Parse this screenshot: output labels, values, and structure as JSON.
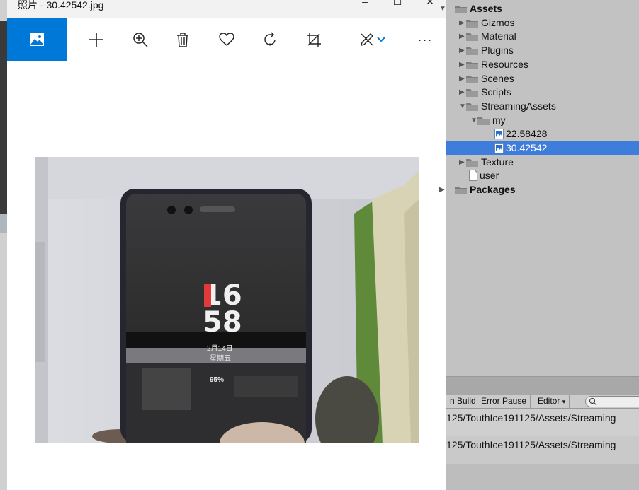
{
  "photos": {
    "title": "照片 - 30.42542.jpg",
    "window_buttons": {
      "minimize": "–",
      "maximize": "☐",
      "close": "✕"
    },
    "accent": "#0078d7",
    "toolbar": [
      "view-image",
      "add",
      "zoom-in",
      "delete",
      "favorite",
      "rotate",
      "crop",
      "edit",
      "more"
    ],
    "more_label": "···",
    "photo": {
      "clock_hour": "16",
      "clock_minute": "58",
      "date_line": "2月14日",
      "weekday_line": "星期五",
      "battery": "95%"
    }
  },
  "unity": {
    "tree": [
      {
        "label": "Assets",
        "type": "folder",
        "expanded": true,
        "bold": true
      },
      {
        "label": "Gizmos",
        "type": "folder"
      },
      {
        "label": "Material",
        "type": "folder"
      },
      {
        "label": "Plugins",
        "type": "folder"
      },
      {
        "label": "Resources",
        "type": "folder"
      },
      {
        "label": "Scenes",
        "type": "folder"
      },
      {
        "label": "Scripts",
        "type": "folder"
      },
      {
        "label": "StreamingAssets",
        "type": "folder",
        "expanded": true
      },
      {
        "label": "my",
        "type": "folder",
        "expanded": true
      },
      {
        "label": "22.58428",
        "type": "image"
      },
      {
        "label": "30.42542",
        "type": "image",
        "selected": true
      },
      {
        "label": "Texture",
        "type": "folder"
      },
      {
        "label": "user",
        "type": "file"
      },
      {
        "label": "Packages",
        "type": "folder",
        "bold": true
      }
    ],
    "console_bar": {
      "build": "n Build",
      "error_pause": "Error Pause",
      "editor": "Editor",
      "editor_arrow": "▾"
    },
    "logs": [
      "125/TouthIce191125/Assets/Streaming",
      "125/TouthIce191125/Assets/Streaming"
    ],
    "selection_color": "#3e7ddc"
  }
}
